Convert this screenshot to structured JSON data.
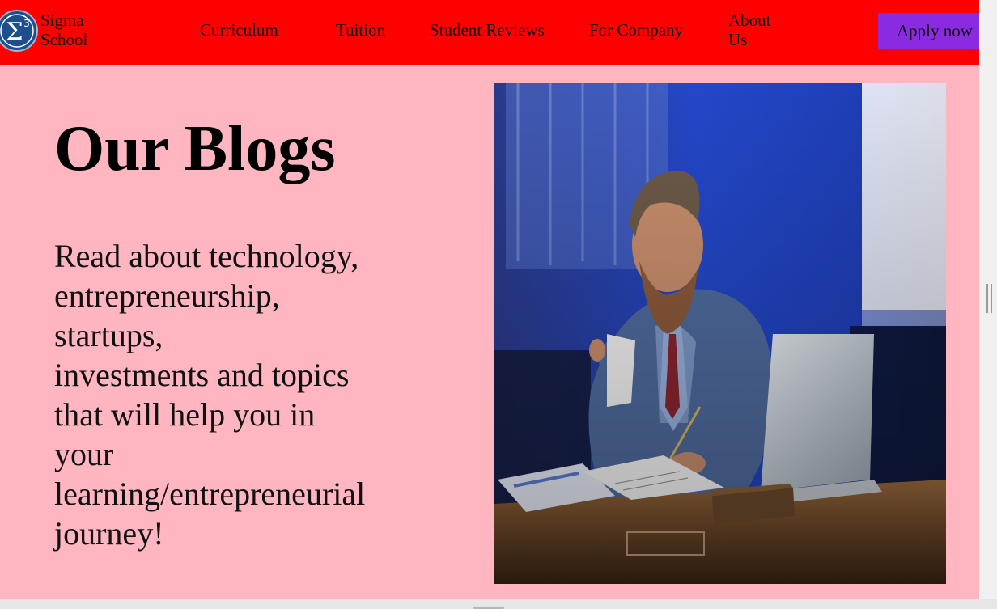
{
  "navbar": {
    "brand_line1": "Sigma",
    "brand_line2": "School",
    "logo_icon": "sigma-cubed-logo",
    "links": [
      "Curriculum",
      "Tuition",
      "Student Reviews",
      "For Company"
    ],
    "about_line1": "About",
    "about_line2": "Us",
    "apply_label": "Apply now",
    "background_color": "#ff0000",
    "apply_color": "#8a2be2"
  },
  "main": {
    "heading": "Our Blogs",
    "intro_lines": [
      "Read about technology,",
      "entrepreneurship,",
      "startups,",
      "investments and topics",
      "that will help you in",
      "your",
      "learning/entrepreneurial",
      "journey!"
    ],
    "background_color": "#ffb6c1",
    "photo": "man-with-coffee-writing-at-laptop-photo"
  }
}
